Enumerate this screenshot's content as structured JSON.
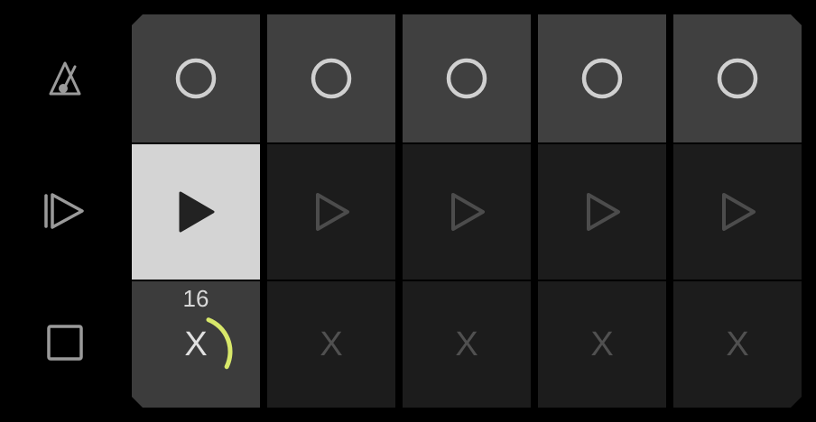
{
  "side": {
    "metronome_icon": "metronome-icon",
    "play_all_icon": "play-all-icon",
    "stop_all_icon": "stop-icon"
  },
  "grid": {
    "columns": 5,
    "record_row": [
      {
        "icon": "record-circle-icon"
      },
      {
        "icon": "record-circle-icon"
      },
      {
        "icon": "record-circle-icon"
      },
      {
        "icon": "record-circle-icon"
      },
      {
        "icon": "record-circle-icon"
      }
    ],
    "play_row": [
      {
        "icon": "play-icon",
        "active": true
      },
      {
        "icon": "play-outline-icon",
        "active": false
      },
      {
        "icon": "play-outline-icon",
        "active": false
      },
      {
        "icon": "play-outline-icon",
        "active": false
      },
      {
        "icon": "play-outline-icon",
        "active": false
      }
    ],
    "stop_row": [
      {
        "label": "X",
        "count": "16",
        "progress": 0.25,
        "active": true
      },
      {
        "label": "X",
        "active": false
      },
      {
        "label": "X",
        "active": false
      },
      {
        "label": "X",
        "active": false
      },
      {
        "label": "X",
        "active": false
      }
    ]
  },
  "colors": {
    "background": "#000000",
    "cell_top": "#404040",
    "cell_dark": "#1c1c1c",
    "cell_active_play": "#d4d4d4",
    "progress_arc": "#d8e86a",
    "icon_light": "#d0d0d0",
    "icon_dim": "#4c4c4c"
  }
}
